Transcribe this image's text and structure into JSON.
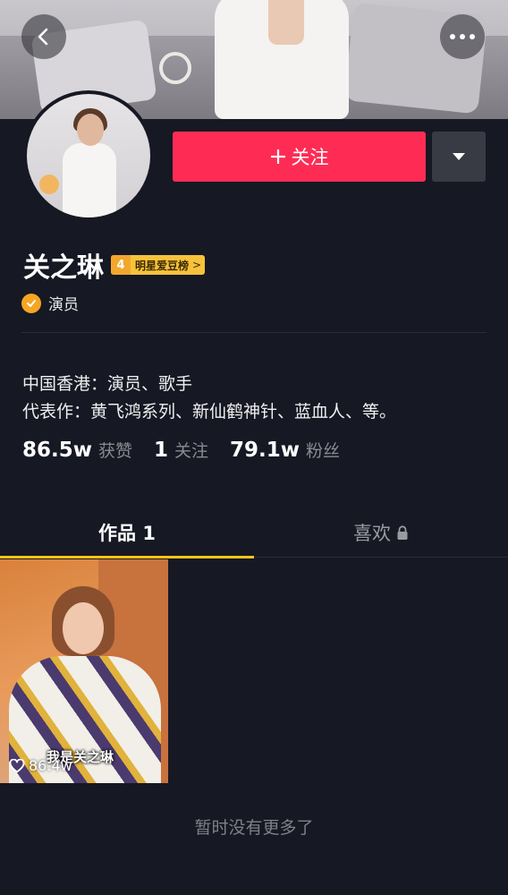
{
  "header": {
    "back_icon": "chevron-left-icon",
    "more_icon": "more-horizontal-icon"
  },
  "profile": {
    "follow_label": "关注",
    "follow_icon": "plus-icon",
    "dropdown_icon": "triangle-down-icon",
    "name": "关之琳",
    "badge": {
      "level": "4",
      "text": "明星爱豆榜",
      "arrow": ">"
    },
    "verified_label": "演员",
    "bio_lines": [
      "中国香港：演员、歌手",
      "代表作：黄飞鸿系列、新仙鹤神针、蓝血人、等。"
    ],
    "stats": [
      {
        "value": "86.5w",
        "label": "获赞"
      },
      {
        "value": "1",
        "label": "关注"
      },
      {
        "value": "79.1w",
        "label": "粉丝"
      }
    ]
  },
  "tabs": [
    {
      "label": "作品 1",
      "active": true
    },
    {
      "label": "喜欢",
      "active": false,
      "icon": "lock-icon"
    }
  ],
  "videos": [
    {
      "caption": "我是关之琳",
      "likes": "86.4w"
    }
  ],
  "footer": {
    "no_more_text": "暂时没有更多了"
  },
  "colors": {
    "background": "#161823",
    "follow_button": "#fe2c55",
    "tab_indicator": "#f5c518",
    "verified": "#f5a623"
  }
}
